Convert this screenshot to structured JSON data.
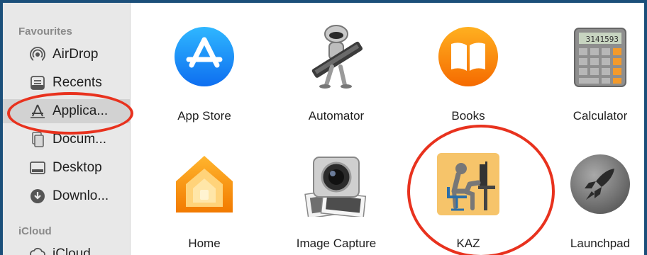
{
  "sidebar": {
    "favourites_label": "Favourites",
    "icloud_label": "iCloud",
    "items": [
      {
        "label": "AirDrop",
        "icon": "airdrop-icon"
      },
      {
        "label": "Recents",
        "icon": "recents-icon"
      },
      {
        "label": "Applica...",
        "icon": "applications-icon",
        "selected": true
      },
      {
        "label": "Docum...",
        "icon": "documents-icon"
      },
      {
        "label": "Desktop",
        "icon": "desktop-icon"
      },
      {
        "label": "Downlo...",
        "icon": "downloads-icon"
      }
    ],
    "icloud_items": [
      {
        "label": "iCloud",
        "icon": "icloud-icon"
      }
    ]
  },
  "apps": [
    {
      "label": "App Store",
      "icon": "app-store-icon"
    },
    {
      "label": "Automator",
      "icon": "automator-icon"
    },
    {
      "label": "Books",
      "icon": "books-icon"
    },
    {
      "label": "Calculator",
      "icon": "calculator-icon"
    },
    {
      "label": "Home",
      "icon": "home-icon"
    },
    {
      "label": "Image Capture",
      "icon": "image-capture-icon"
    },
    {
      "label": "KAZ",
      "icon": "kaz-icon"
    },
    {
      "label": "Launchpad",
      "icon": "launchpad-icon"
    }
  ],
  "calculator_display": "3141593",
  "colors": {
    "frame_border": "#1b4f7a",
    "annotation": "#e8321e",
    "sidebar_bg": "#e8e8e8",
    "selected_bg": "#d2d2d2"
  }
}
